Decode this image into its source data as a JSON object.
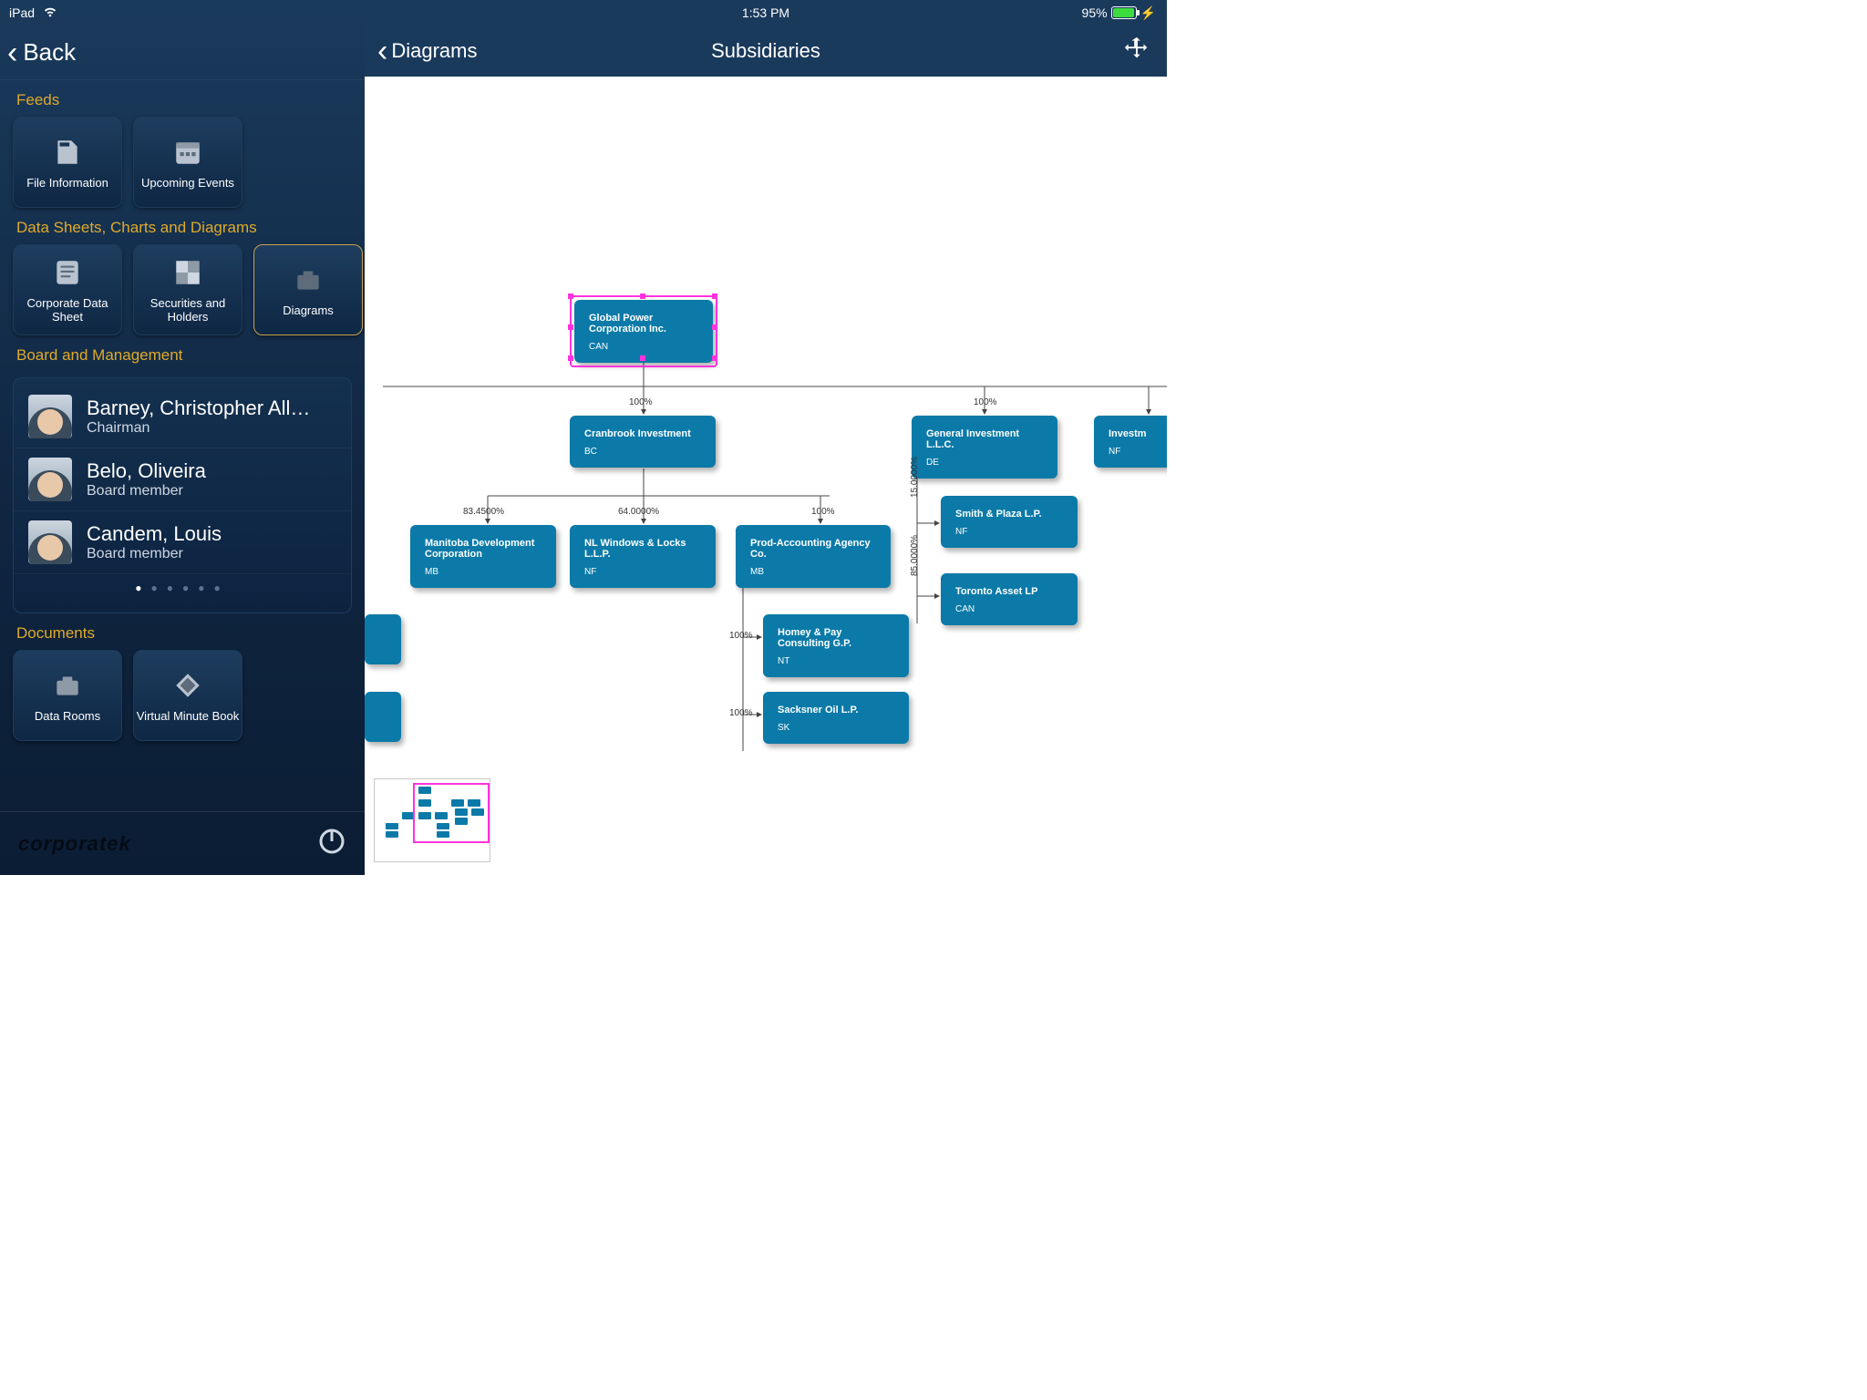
{
  "status": {
    "device": "iPad",
    "time": "1:53 PM",
    "battery_pct": "95%"
  },
  "sidebar": {
    "back_label": "Back",
    "sections": {
      "feeds": {
        "label": "Feeds",
        "tiles": [
          "File Information",
          "Upcoming Events"
        ]
      },
      "datasheets": {
        "label": "Data Sheets, Charts and Diagrams",
        "tiles": [
          "Corporate Data Sheet",
          "Securities and Holders",
          "Diagrams"
        ],
        "selected": 2
      },
      "board": {
        "label": "Board and Management",
        "people": [
          {
            "name": "Barney, Christopher All…",
            "role": "Chairman"
          },
          {
            "name": "Belo, Oliveira",
            "role": "Board member"
          },
          {
            "name": "Candem, Louis",
            "role": "Board member"
          }
        ],
        "page_index": 0,
        "page_count": 6
      },
      "documents": {
        "label": "Documents",
        "tiles": [
          "Data Rooms",
          "Virtual Minute Book"
        ]
      }
    },
    "brand": "corporatek"
  },
  "main": {
    "back_label": "Diagrams",
    "title": "Subsidiaries"
  },
  "chart_data": {
    "type": "orgchart",
    "root": {
      "name": "Global Power Corporation Inc.",
      "country": "CAN",
      "selected": true
    },
    "edges": [
      {
        "from": "root",
        "to": "cranbrook",
        "pct": "100%"
      },
      {
        "from": "root",
        "to": "general",
        "pct": "100%"
      },
      {
        "from": "root",
        "to": "invest_right",
        "pct": ""
      },
      {
        "from": "cranbrook",
        "to": "manitoba",
        "pct": "83.4500%"
      },
      {
        "from": "cranbrook",
        "to": "nlwindows",
        "pct": "64.0000%"
      },
      {
        "from": "cranbrook",
        "to": "prodacct",
        "pct": "100%"
      },
      {
        "from": "prodacct",
        "to": "homey",
        "pct": "100%"
      },
      {
        "from": "prodacct",
        "to": "sacksner",
        "pct": "100%"
      },
      {
        "from": "general",
        "to": "smith",
        "pct": "15.0000%"
      },
      {
        "from": "general",
        "to": "toronto",
        "pct": "85.0000%"
      }
    ],
    "nodes": {
      "cranbrook": {
        "name": "Cranbrook Investment",
        "country": "BC"
      },
      "general": {
        "name": "General Investment L.L.C.",
        "country": "DE"
      },
      "invest_right": {
        "name": "Investm",
        "country": "NF"
      },
      "manitoba": {
        "name": "Manitoba Development Corporation",
        "country": "MB"
      },
      "nlwindows": {
        "name": "NL Windows & Locks L.L.P.",
        "country": "NF"
      },
      "prodacct": {
        "name": "Prod-Accounting Agency Co.",
        "country": "MB"
      },
      "homey": {
        "name": "Homey & Pay Consulting G.P.",
        "country": "NT"
      },
      "sacksner": {
        "name": "Sacksner Oil L.P.",
        "country": "SK"
      },
      "smith": {
        "name": "Smith & Plaza L.P.",
        "country": "NF"
      },
      "toronto": {
        "name": "Toronto Asset LP",
        "country": "CAN"
      },
      "frag_a": {
        "name": "",
        "country": ""
      },
      "frag_b": {
        "name": "",
        "country": ""
      }
    }
  }
}
